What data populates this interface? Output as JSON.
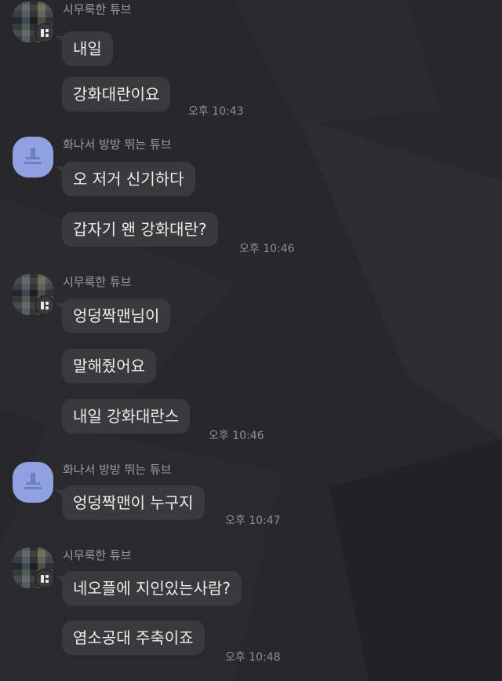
{
  "messages": [
    {
      "sender": "시무룩한 튜브",
      "avatar": "photo",
      "bubbles": [
        "내일",
        "강화대란이요"
      ],
      "time": "오후 10:43"
    },
    {
      "sender": "화나서 방방 뛰는 튜브",
      "avatar": "default",
      "bubbles": [
        "오 저거 신기하다",
        "갑자기 왠 강화대란?"
      ],
      "time": "오후 10:46"
    },
    {
      "sender": "시무룩한 튜브",
      "avatar": "photo",
      "bubbles": [
        "엉덩짝맨님이",
        "말해줬어요",
        "내일 강화대란스"
      ],
      "time": "오후 10:46"
    },
    {
      "sender": "화나서 방방 뛰는 튜브",
      "avatar": "default",
      "bubbles": [
        "엉덩짝맨이 누구지"
      ],
      "time": "오후 10:47"
    },
    {
      "sender": "시무룩한 튜브",
      "avatar": "photo",
      "bubbles": [
        "네오플에 지인있는사람?",
        "염소공대 주축이죠"
      ],
      "time": "오후 10:48"
    }
  ],
  "icons": {
    "profile_badge": "profile-badge-icon",
    "default_avatar": "default-profile-icon"
  },
  "colors": {
    "background": "#28282a",
    "bubble": "#3a3a3c",
    "bubble_text": "#ededed",
    "sender_name": "#9c9c9f",
    "timestamp": "#8f8f93",
    "default_avatar": "#8fa1e0"
  }
}
